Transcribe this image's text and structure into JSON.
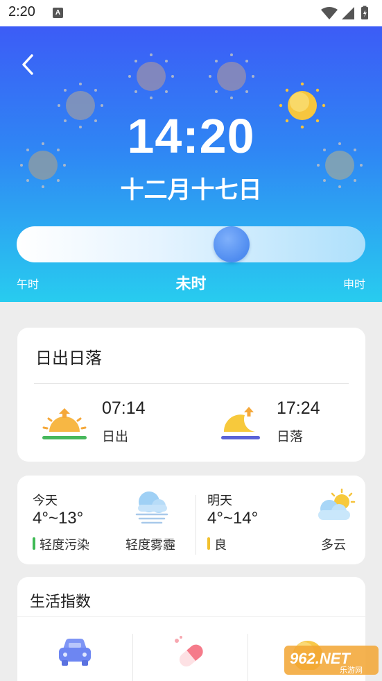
{
  "status_bar": {
    "time": "2:20",
    "notification_badge": "A",
    "icons": [
      "wifi-icon",
      "signal-icon",
      "battery-icon"
    ]
  },
  "hero": {
    "time": "14:20",
    "date": "十二月十七日",
    "slider": {
      "left_label": "午时",
      "current_label": "未时",
      "right_label": "申时",
      "position": 0.6
    },
    "colors": {
      "gradient_top": "#3c5cf6",
      "gradient_bottom": "#28ccef"
    }
  },
  "sun_card": {
    "title": "日出日落",
    "sunrise": {
      "time": "07:14",
      "label": "日出",
      "accent": "#47b85c"
    },
    "sunset": {
      "time": "17:24",
      "label": "日落",
      "accent": "#5a63d8"
    }
  },
  "forecast": {
    "today": {
      "day": "今天",
      "temp": "4°~13°",
      "air_quality": "轻度污染",
      "aq_color": "#3fba55",
      "condition": "轻度雾霾"
    },
    "tomorrow": {
      "day": "明天",
      "temp": "4°~14°",
      "air_quality": "良",
      "aq_color": "#f2c12e",
      "condition": "多云"
    }
  },
  "life_index": {
    "title": "生活指数",
    "items": [
      "car-icon",
      "pill-icon",
      "sun-icon"
    ]
  },
  "watermark": {
    "logo_text": "962.NET",
    "sub_text": "乐游网"
  }
}
